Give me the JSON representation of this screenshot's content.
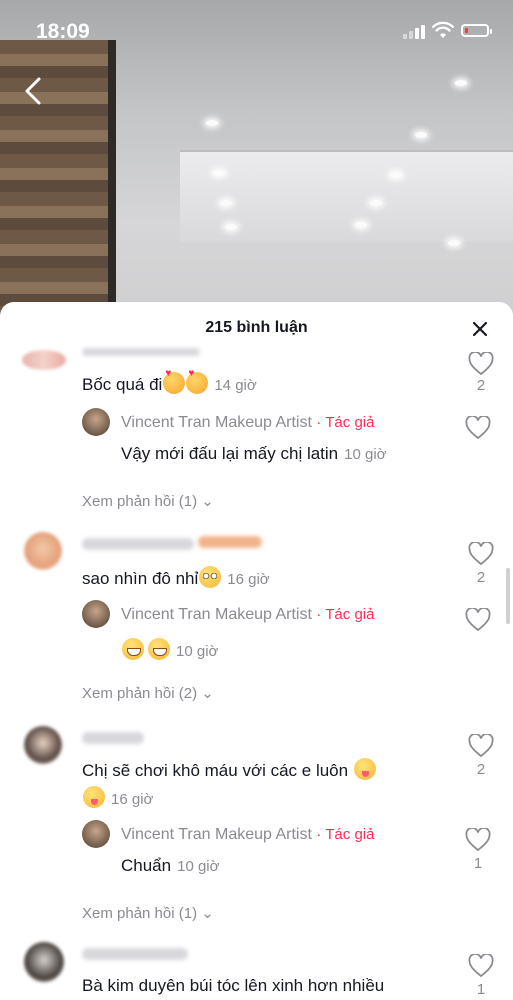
{
  "status_bar": {
    "time": "18:09"
  },
  "sheet": {
    "title": "215 bình luận"
  },
  "comments": [
    {
      "text": "Bốc quá đi",
      "time": "14 giờ",
      "likes": "2",
      "reply": {
        "author": "Vincent Tran Makeup Artist",
        "tag": "· Tác giả",
        "text": "Vậy mới đấu lại mấy chị latin",
        "time": "10 giờ"
      },
      "view_replies": "Xem phản hồi (1)"
    },
    {
      "text": "sao nhìn đô nhỉ",
      "time": "16 giờ",
      "likes": "2",
      "reply": {
        "author": "Vincent Tran Makeup Artist",
        "tag": "· Tác giả",
        "text": "",
        "time": "10 giờ"
      },
      "view_replies": "Xem phản hồi (2)"
    },
    {
      "text": "Chị sẽ chơi khô máu với các e luôn",
      "time": "16 giờ",
      "likes": "2",
      "reply": {
        "author": "Vincent Tran Makeup Artist",
        "tag": "· Tác giả",
        "text": "Chuẩn",
        "time": "10 giờ",
        "likes": "1"
      },
      "view_replies": "Xem phản hồi (1)"
    },
    {
      "text": "Bà kim duyên búi tóc lên xinh hơn nhiều",
      "likes": "1"
    }
  ]
}
